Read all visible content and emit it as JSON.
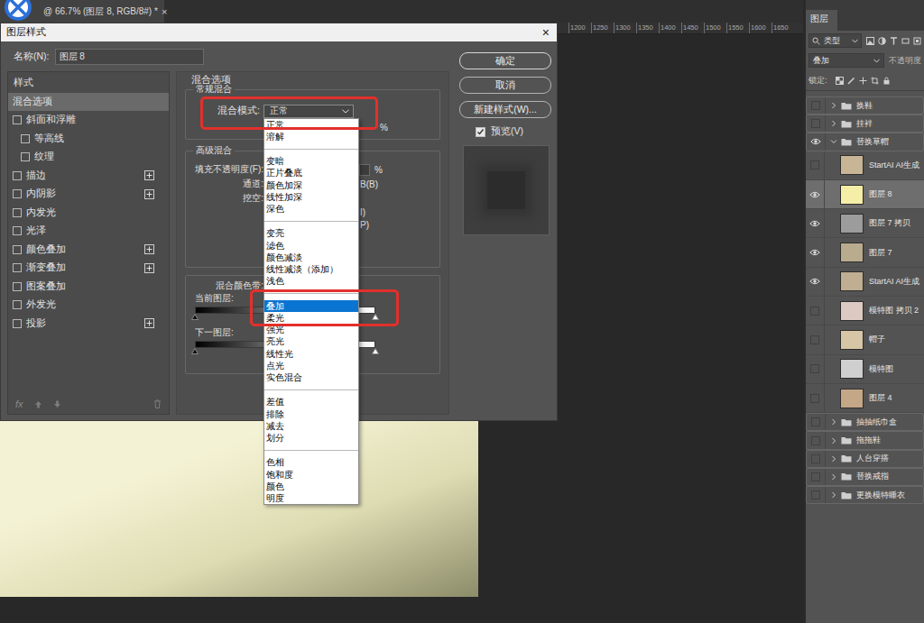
{
  "document": {
    "tab_title": "@ 66.7% (图层 8, RGB/8#) *",
    "tab_close": "×",
    "ruler_ticks": [
      "1200",
      "1250",
      "1300",
      "1350",
      "1400",
      "1450",
      "1500",
      "1550",
      "1600",
      "1650"
    ]
  },
  "dialog": {
    "title": "图层样式",
    "close": "×",
    "name_label": "名称(N):",
    "name_value": "图层 8",
    "styles": {
      "header": "样式",
      "toolbar_fx": "fx",
      "items": [
        {
          "label": "混合选项",
          "kind": "plain",
          "selected": true,
          "addable": false
        },
        {
          "label": "斜面和浮雕",
          "kind": "check",
          "selected": false,
          "checked": false,
          "addable": false
        },
        {
          "label": "等高线",
          "kind": "sub",
          "selected": false,
          "checked": false,
          "addable": false
        },
        {
          "label": "纹理",
          "kind": "sub",
          "selected": false,
          "checked": false,
          "addable": false
        },
        {
          "label": "描边",
          "kind": "check",
          "selected": false,
          "checked": false,
          "addable": true
        },
        {
          "label": "内阴影",
          "kind": "check",
          "selected": false,
          "checked": false,
          "addable": true
        },
        {
          "label": "内发光",
          "kind": "check",
          "selected": false,
          "checked": false,
          "addable": false
        },
        {
          "label": "光泽",
          "kind": "check",
          "selected": false,
          "checked": false,
          "addable": false
        },
        {
          "label": "颜色叠加",
          "kind": "check",
          "selected": false,
          "checked": false,
          "addable": true
        },
        {
          "label": "渐变叠加",
          "kind": "check",
          "selected": false,
          "checked": false,
          "addable": true
        },
        {
          "label": "图案叠加",
          "kind": "check",
          "selected": false,
          "checked": false,
          "addable": false
        },
        {
          "label": "外发光",
          "kind": "check",
          "selected": false,
          "checked": false,
          "addable": false
        },
        {
          "label": "投影",
          "kind": "check",
          "selected": false,
          "checked": false,
          "addable": true
        }
      ]
    },
    "blending": {
      "title": "混合选项",
      "general": {
        "title": "常规混合",
        "mode_label": "混合模式:",
        "mode_value": "正常",
        "opacity_unit": "%"
      },
      "advanced": {
        "title": "高级混合",
        "fill_label": "填充不透明度(F):",
        "fill_unit": "%",
        "channels_label": "通道:",
        "channel_fragment": "B(B)",
        "knockout_label": "挖空:",
        "fragments": [
          "I)",
          "P)"
        ]
      },
      "blend_if": {
        "title": "混合颜色带:",
        "current": {
          "label": "当前图层:",
          "low": 0,
          "high": 1
        },
        "underlying": {
          "label": "下一图层:",
          "low": 0,
          "high": 1
        }
      }
    },
    "buttons": [
      {
        "label": "确定"
      },
      {
        "label": "取消"
      },
      {
        "label": "新建样式(W)..."
      }
    ],
    "preview": {
      "label": "预览(V)",
      "checked": true
    }
  },
  "blend_menu": {
    "groups": [
      [
        {
          "label": "正常",
          "selected": false
        },
        {
          "label": "溶解",
          "selected": false
        }
      ],
      [
        {
          "label": "变暗",
          "selected": false
        },
        {
          "label": "正片叠底",
          "selected": false
        },
        {
          "label": "颜色加深",
          "selected": false
        },
        {
          "label": "线性加深",
          "selected": false
        },
        {
          "label": "深色",
          "selected": false
        }
      ],
      [
        {
          "label": "变亮",
          "selected": false
        },
        {
          "label": "滤色",
          "selected": false
        },
        {
          "label": "颜色减淡",
          "selected": false
        },
        {
          "label": "线性减淡（添加）",
          "selected": false
        },
        {
          "label": "浅色",
          "selected": false
        }
      ],
      [
        {
          "label": "叠加",
          "selected": true
        },
        {
          "label": "柔光",
          "selected": false
        },
        {
          "label": "强光",
          "selected": false
        },
        {
          "label": "亮光",
          "selected": false
        },
        {
          "label": "线性光",
          "selected": false
        },
        {
          "label": "点光",
          "selected": false
        },
        {
          "label": "实色混合",
          "selected": false
        }
      ],
      [
        {
          "label": "差值",
          "selected": false
        },
        {
          "label": "排除",
          "selected": false
        },
        {
          "label": "减去",
          "selected": false
        },
        {
          "label": "划分",
          "selected": false
        }
      ],
      [
        {
          "label": "色相",
          "selected": false
        },
        {
          "label": "饱和度",
          "selected": false
        },
        {
          "label": "颜色",
          "selected": false
        },
        {
          "label": "明度",
          "selected": false
        }
      ]
    ]
  },
  "layers_panel": {
    "title": "图层",
    "filter_label": "类型",
    "blend_mode": "叠加",
    "opacity_label": "不透明度",
    "lock_label": "锁定:",
    "layers": [
      {
        "name": "换鞋",
        "kind": "group",
        "visible": false,
        "selected": false,
        "expanded": false
      },
      {
        "name": "挂袢",
        "kind": "group",
        "visible": false,
        "selected": false,
        "expanded": false
      },
      {
        "name": "替换草帽",
        "kind": "group",
        "visible": true,
        "selected": false,
        "expanded": true
      },
      {
        "name": "StartAI AI生成",
        "kind": "layer",
        "visible": false,
        "selected": false,
        "color": "#c7b595"
      },
      {
        "name": "图层 8",
        "kind": "layer",
        "visible": true,
        "selected": true,
        "color": "#f5eea6"
      },
      {
        "name": "图层 7 拷贝",
        "kind": "layer",
        "visible": true,
        "selected": false,
        "color": "#9c9c9c"
      },
      {
        "name": "图层 7",
        "kind": "layer",
        "visible": true,
        "selected": false,
        "color": "#b9ab8e"
      },
      {
        "name": "StartAI AI生成",
        "kind": "layer",
        "visible": true,
        "selected": false,
        "color": "#bfae92"
      },
      {
        "name": "模特图 拷贝 2",
        "kind": "layer",
        "visible": false,
        "selected": false,
        "color": "#dccac2"
      },
      {
        "name": "帽子",
        "kind": "layer",
        "visible": false,
        "selected": false,
        "color": "#d7c6a6"
      },
      {
        "name": "模特图",
        "kind": "layer",
        "visible": false,
        "selected": false,
        "color": "#cfcfcf"
      },
      {
        "name": "图层 4",
        "kind": "layer",
        "visible": false,
        "selected": false,
        "color": "#c4a787"
      },
      {
        "name": "抽抽纸巾盒",
        "kind": "group",
        "visible": false,
        "selected": false,
        "expanded": false
      },
      {
        "name": "拖拖鞋",
        "kind": "group",
        "visible": false,
        "selected": false,
        "expanded": false
      },
      {
        "name": "人台穿搭",
        "kind": "group",
        "visible": false,
        "selected": false,
        "expanded": false
      },
      {
        "name": "替换戒指",
        "kind": "group",
        "visible": false,
        "selected": false,
        "expanded": false
      },
      {
        "name": "更换模特睡衣",
        "kind": "group",
        "visible": false,
        "selected": false,
        "expanded": false
      }
    ]
  }
}
